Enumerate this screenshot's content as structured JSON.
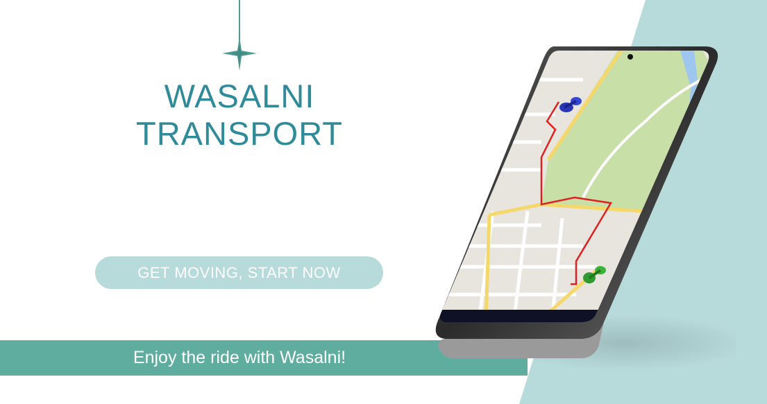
{
  "title": {
    "line1": "WASALNI",
    "line2": "TRANSPORT"
  },
  "cta": {
    "label": "GET MOVING, START NOW"
  },
  "tagline": "Enjoy the ride with Wasalni!",
  "colors": {
    "title": "#2f8a99",
    "accent_teal": "#5fad9e",
    "wedge": "#b7dadb",
    "button": "#b7dadb"
  },
  "icons": {
    "pendant": "star-icon",
    "start_pin": "map-pin-icon",
    "end_pin": "map-pin-icon"
  }
}
